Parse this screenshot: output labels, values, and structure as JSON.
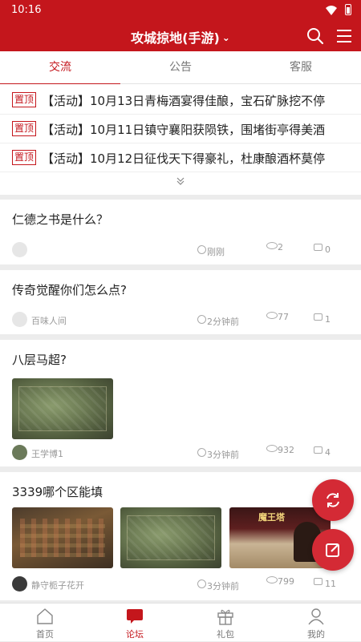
{
  "status_bar": {
    "time": "10:16"
  },
  "app_bar": {
    "title": "攻城掠地(手游)"
  },
  "tabs": [
    {
      "label": "交流",
      "active": true
    },
    {
      "label": "公告",
      "active": false
    },
    {
      "label": "客服",
      "active": false
    }
  ],
  "pinned": {
    "tag": "置顶",
    "items": [
      {
        "text": "【活动】10月13日青梅酒宴得佳酿，宝石矿脉挖不停"
      },
      {
        "text": "【活动】10月11日镇守襄阳获陨铁，围堵街亭得美酒"
      },
      {
        "text": "【活动】10月12日征伐天下得豪礼，杜康酿酒杯莫停"
      }
    ]
  },
  "posts": [
    {
      "title": "仁德之书是什么？",
      "author": "",
      "time": "刚刚",
      "views": "2",
      "comments": "0"
    },
    {
      "title": "传奇觉醒你们怎么点?",
      "author": "百味人间",
      "time": "2分钟前",
      "views": "77",
      "comments": "1"
    },
    {
      "title": "八层马超?",
      "author": "王学博1",
      "time": "3分钟前",
      "views": "932",
      "comments": "4"
    },
    {
      "title": "3339哪个区能填",
      "author": "静守栀子花开",
      "time": "3分钟前",
      "views": "799",
      "comments": "11",
      "thumb_badge": "魔王塔"
    }
  ],
  "bottom_nav": [
    {
      "label": "首页",
      "active": false
    },
    {
      "label": "论坛",
      "active": true
    },
    {
      "label": "礼包",
      "active": false
    },
    {
      "label": "我的",
      "active": false
    }
  ],
  "colors": {
    "brand": "#c4161c",
    "fab": "#d42a35"
  }
}
